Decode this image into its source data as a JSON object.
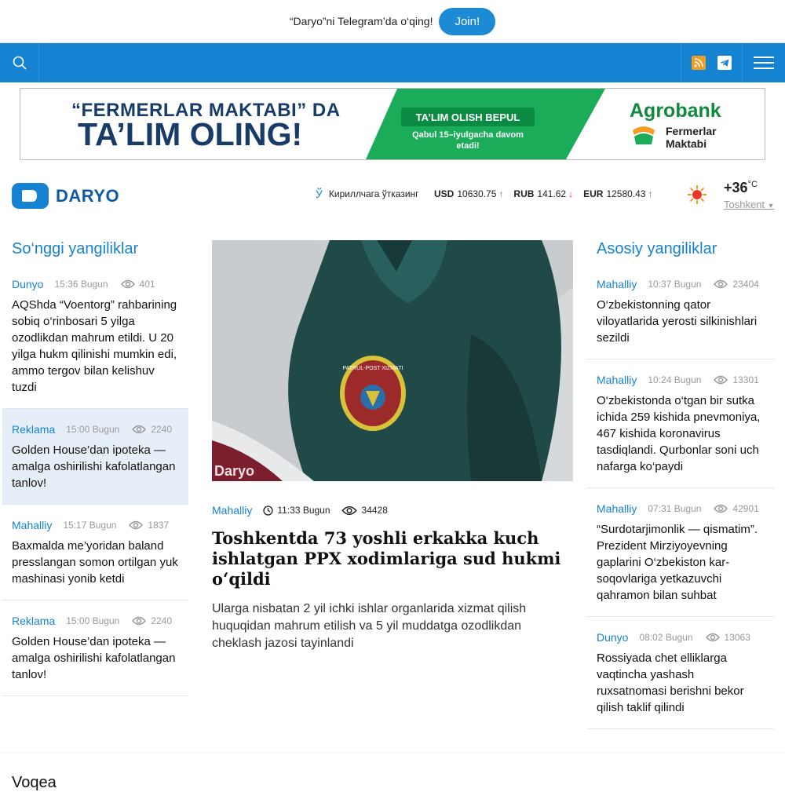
{
  "telegram_bar": {
    "text": "“Daryo”ni Telegram’da o‘qing!",
    "join_label": "Join!"
  },
  "nav": {
    "icons": [
      "search-icon",
      "rss-icon",
      "telegram-icon",
      "menu-icon"
    ]
  },
  "banner": {
    "line1": "“FERMERLAR MAKTABI” DA",
    "line2": "TA’LIM OLING!",
    "pill": "TA’LIM OLISH BEPUL",
    "sub": "Qabul 15–iyulgacha davom etadi!",
    "brand": "Agrobank",
    "partner_line1": "Fermerlar",
    "partner_line2": "Maktabi"
  },
  "header": {
    "logo_text": "DARYO",
    "cyrillic_icon": "Ў",
    "cyrillic_label": "Кириллчага ўтказинг",
    "rates": [
      {
        "code": "USD",
        "value": "10630.75",
        "trend": "up"
      },
      {
        "code": "RUB",
        "value": "141.62",
        "trend": "down"
      },
      {
        "code": "EUR",
        "value": "12580.43",
        "trend": "up"
      }
    ],
    "weather": {
      "temp": "+36",
      "unit": "°C",
      "city": "Toshkent"
    }
  },
  "latest": {
    "title": "So‘nggi yangiliklar",
    "items": [
      {
        "category": "Dunyo",
        "time": "15:36 Bugun",
        "views": "401",
        "title": "AQShda “Voentorg” rahbarining sobiq o‘rinbosari 5 yilga ozodlikdan mahrum etildi. U 20 yilga hukm qilinishi mumkin edi, ammo tergov bilan kelishuv tuzdi"
      },
      {
        "category": "Reklama",
        "time": "15:00 Bugun",
        "views": "2240",
        "title": "Golden House’dan ipoteka — amalga oshirilishi kafolatlangan tanlov!"
      },
      {
        "category": "Mahalliy",
        "time": "15:17 Bugun",
        "views": "1837",
        "title": "Baxmalda me’yoridan baland presslangan somon ortilgan yuk mashinasi yonib ketdi"
      },
      {
        "category": "Reklama",
        "time": "15:00 Bugun",
        "views": "2240",
        "title": "Golden House’dan ipoteka — amalga oshirilishi kafolatlangan tanlov!"
      }
    ]
  },
  "main": {
    "photo_watermark": "Daryo",
    "patch_text": "PATRUL-POST XIZMATI",
    "category": "Mahalliy",
    "time": "11:33 Bugun",
    "views": "34428",
    "title": "Toshkentda 73 yoshli erkakka kuch ishlatgan PPX xodimlariga sud hukmi o‘qildi",
    "lead": "Ularga nisbatan 2 yil ichki ishlar organlarida xizmat qilish huquqidan mahrum etilish va 5 yil muddatga ozodlikdan cheklash jazosi tayinlandi"
  },
  "top": {
    "title": "Asosiy yangiliklar",
    "items": [
      {
        "category": "Mahalliy",
        "time": "10:37 Bugun",
        "views": "23404",
        "title": "O‘zbekistonning qator viloyatlarida yerosti silkinishlari sezildi"
      },
      {
        "category": "Mahalliy",
        "time": "10:24 Bugun",
        "views": "13301",
        "title": "O‘zbekistonda o‘tgan bir sutka ichida 259 kishida pnevmoniya, 467 kishida koronavirus tasdiqlandi. Qurbonlar soni uch nafarga ko‘paydi"
      },
      {
        "category": "Mahalliy",
        "time": "07:31 Bugun",
        "views": "42901",
        "title": "“Surdotarjimonlik — qismatim”. Prezident Mirziyoyevning gaplarini O‘zbekiston kar-soqovlariga yetkazuvchi qahramon bilan suhbat"
      },
      {
        "category": "Dunyo",
        "time": "08:02 Bugun",
        "views": "13063",
        "title": "Rossiyada chet elliklarga vaqtincha yashash ruxsatnomasi berishni bekor qilish taklif qilindi"
      }
    ]
  },
  "bottom": {
    "title": "Voqea"
  }
}
